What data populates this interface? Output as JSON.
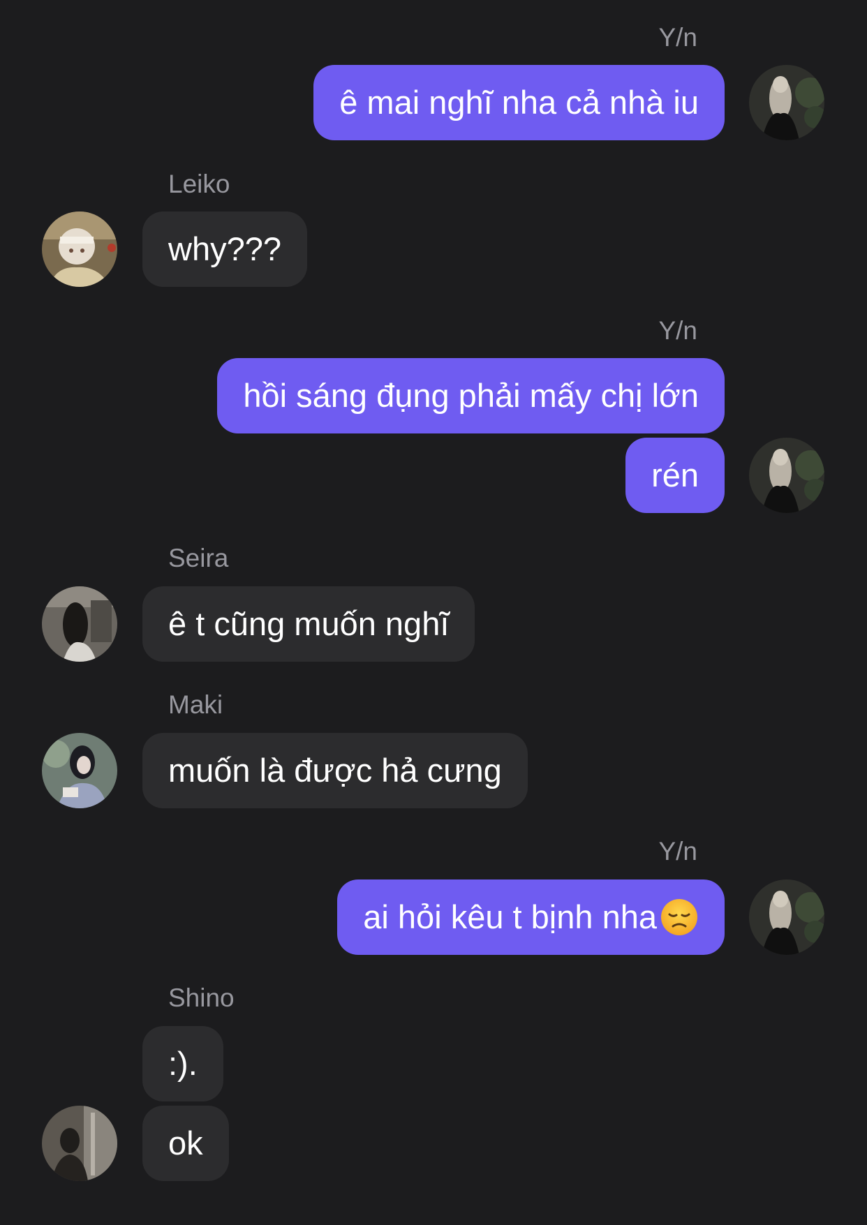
{
  "messages": [
    {
      "sender": "Y/n",
      "text": "ê mai nghĩ nha cả nhà iu"
    },
    {
      "sender": "Leiko",
      "text": "why???"
    },
    {
      "sender": "Y/n",
      "text": "hồi sáng đụng phải mấy chị lớn"
    },
    {
      "sender": "Y/n",
      "text": "rén"
    },
    {
      "sender": "Seira",
      "text": "ê t cũng muốn nghĩ"
    },
    {
      "sender": "Maki",
      "text": "muốn là được hả cưng"
    },
    {
      "sender": "Y/n",
      "text": "ai hỏi kêu t bịnh nha",
      "emoji": "disappointed-face-emoji"
    },
    {
      "sender": "Shino",
      "text": ":)."
    },
    {
      "sender": "Shino",
      "text": "ok"
    }
  ],
  "colors": {
    "background": "#1c1c1e",
    "outgoing_bubble": "#6f5cf1",
    "incoming_bubble": "#2c2c2e",
    "sender_name": "#98989f"
  }
}
